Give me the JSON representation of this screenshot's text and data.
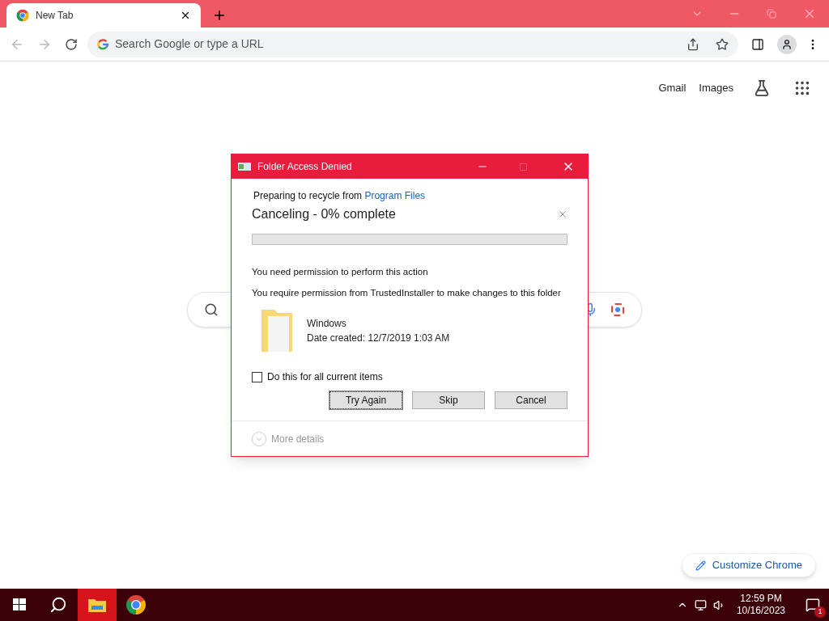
{
  "browser": {
    "tab": {
      "title": "New Tab"
    },
    "address": {
      "placeholder": "Search Google or type a URL"
    }
  },
  "page": {
    "links": [
      "Gmail",
      "Images"
    ],
    "customize": "Customize Chrome"
  },
  "dialog": {
    "title": "Folder Access Denied",
    "preparing": "Preparing to recycle from",
    "source_link": "Program Files",
    "status": "Canceling - 0% complete",
    "progress": {
      "level": 0
    },
    "messages": [
      "You need permission to perform this action",
      "You require permission from TrustedInstaller to make changes to this folder"
    ],
    "item": {
      "name": "Windows",
      "date": "Date created: 12/7/2019 1:03 AM"
    },
    "apply_all": {
      "label": "Do this for all current items",
      "checked": false
    },
    "buttons": [
      {
        "label": "Try Again",
        "focused": true
      },
      {
        "label": "Skip",
        "focused": false
      },
      {
        "label": "Cancel",
        "focused": false
      }
    ],
    "more_details": "More details"
  },
  "taskbar": {
    "apps": [
      {
        "kind": "explorer",
        "selected": true
      },
      {
        "kind": "chrome",
        "selected": false
      }
    ],
    "time": "12:59 PM",
    "date": "10/16/2023",
    "notifications": "1"
  }
}
